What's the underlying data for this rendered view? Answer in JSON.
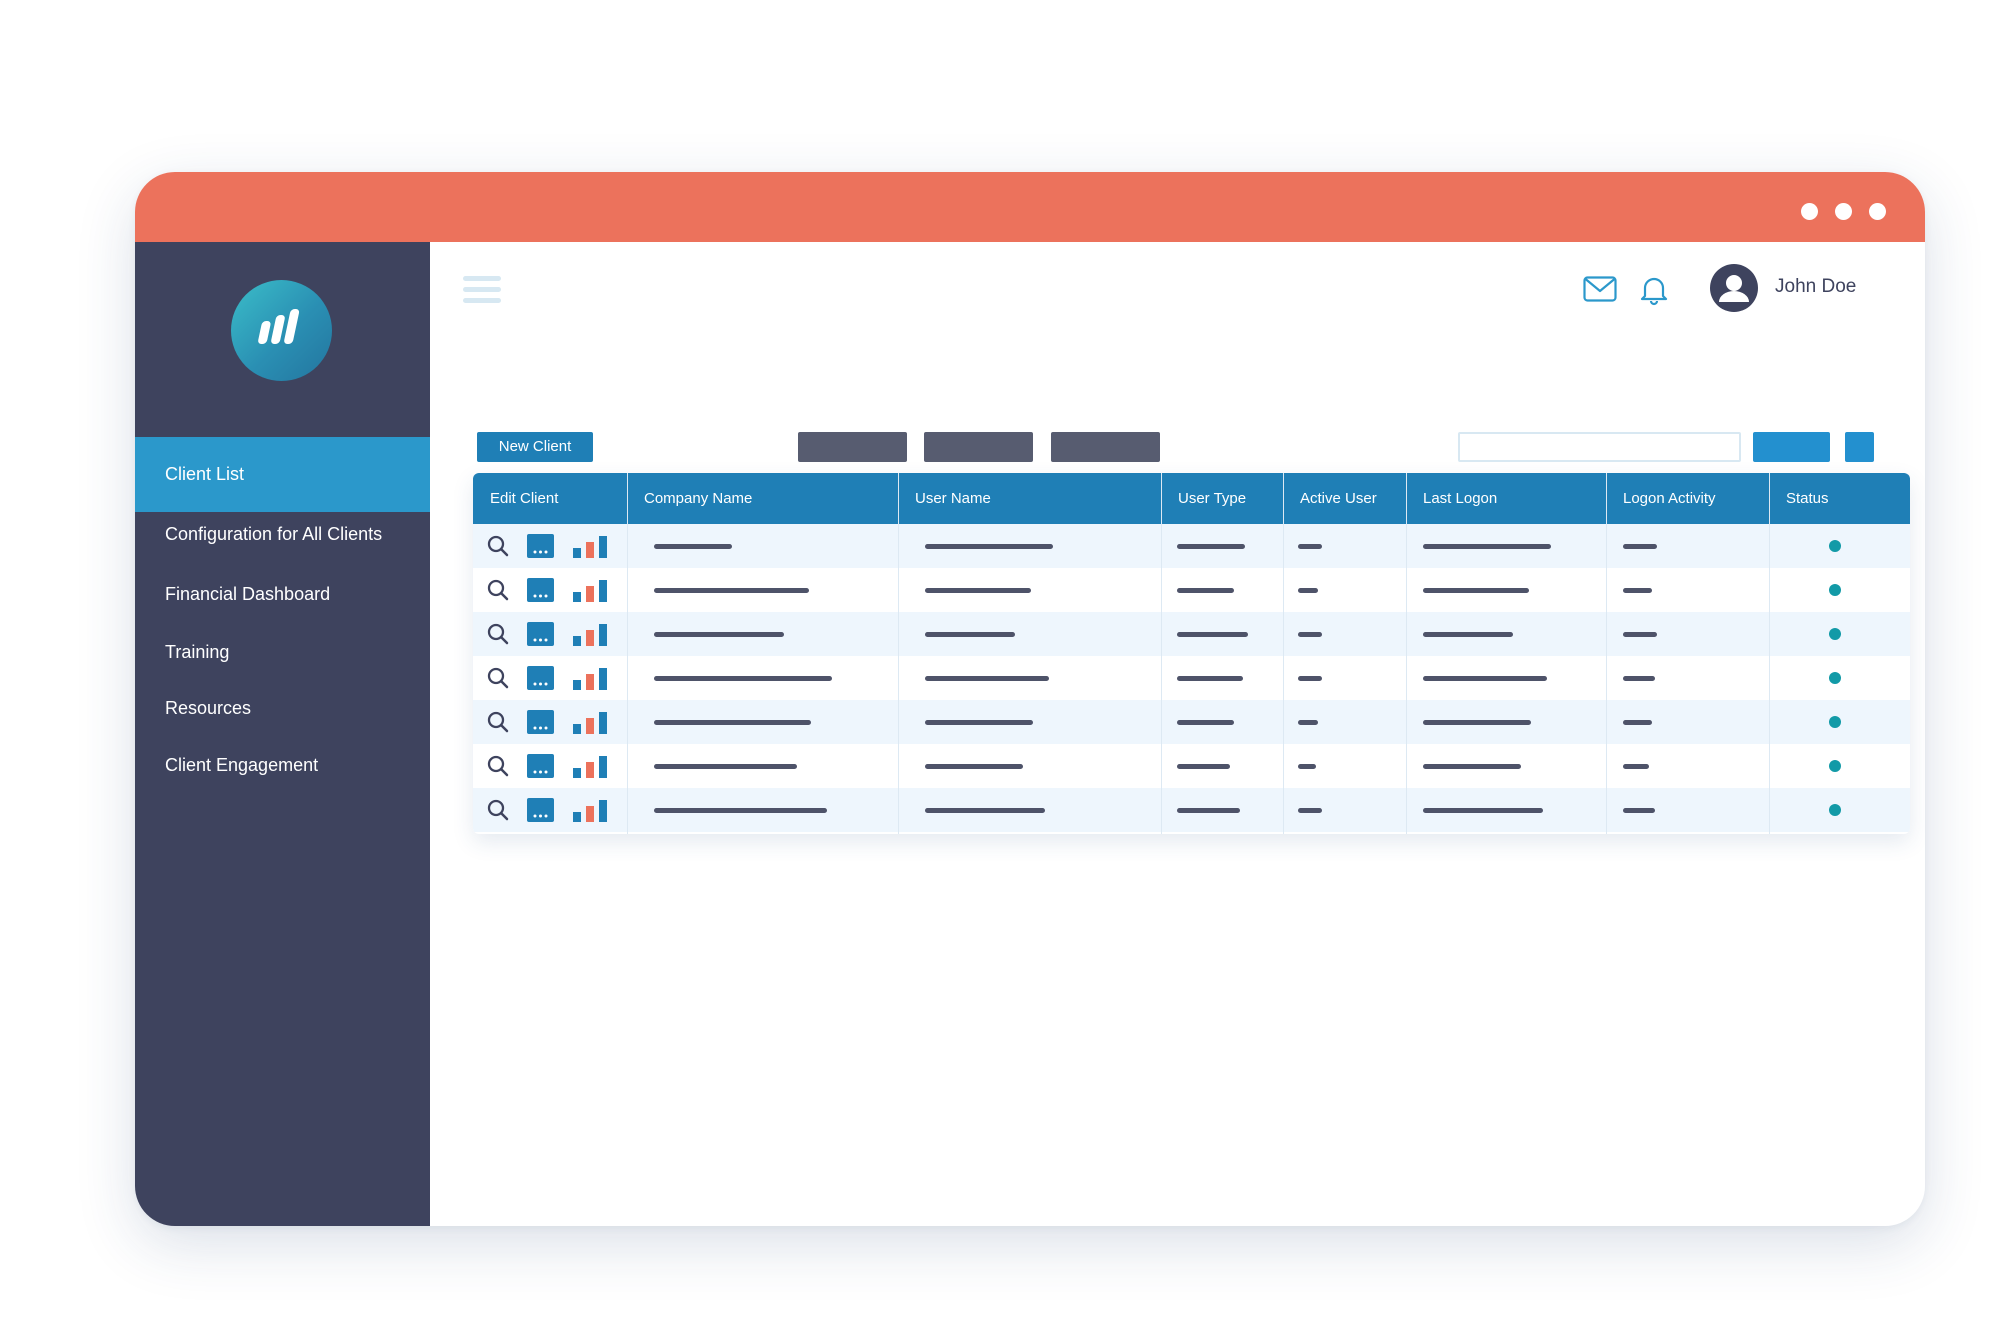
{
  "colors": {
    "titlebar": "#ec725c",
    "sidebar": "#3e435e",
    "sidebar_active": "#2b98cb",
    "table_header": "#1f7fb6",
    "status_active": "#129aa7",
    "row_alt": "#eef6fd"
  },
  "window": {
    "control_icons": [
      "dot-icon",
      "dot-icon",
      "dot-icon"
    ]
  },
  "sidebar": {
    "logo_icon": "bar-chart-logo-icon",
    "items": [
      {
        "label": "Client List",
        "active": true
      },
      {
        "label": "Configuration for All Clients",
        "active": false
      },
      {
        "label": "Financial Dashboard",
        "active": false
      },
      {
        "label": "Training",
        "active": false
      },
      {
        "label": "Resources",
        "active": false
      },
      {
        "label": "Client Engagement",
        "active": false
      }
    ]
  },
  "header": {
    "menu_icon": "hamburger-icon",
    "mail_icon": "envelope-icon",
    "bell_icon": "bell-icon",
    "user_name": "John Doe",
    "avatar_icon": "user-avatar-icon"
  },
  "toolbar": {
    "new_client_label": "New Client",
    "search_value": ""
  },
  "table": {
    "columns": [
      "Edit Client",
      "Company Name",
      "User Name",
      "User Type",
      "Active User",
      "Last Logon",
      "Logon Activity",
      "Status"
    ],
    "edit_icons": [
      "magnifier-icon",
      "more-options-icon",
      "bar-chart-icon"
    ],
    "row_count": 7,
    "rows_status": [
      "active",
      "active",
      "active",
      "active",
      "active",
      "active",
      "active"
    ]
  }
}
